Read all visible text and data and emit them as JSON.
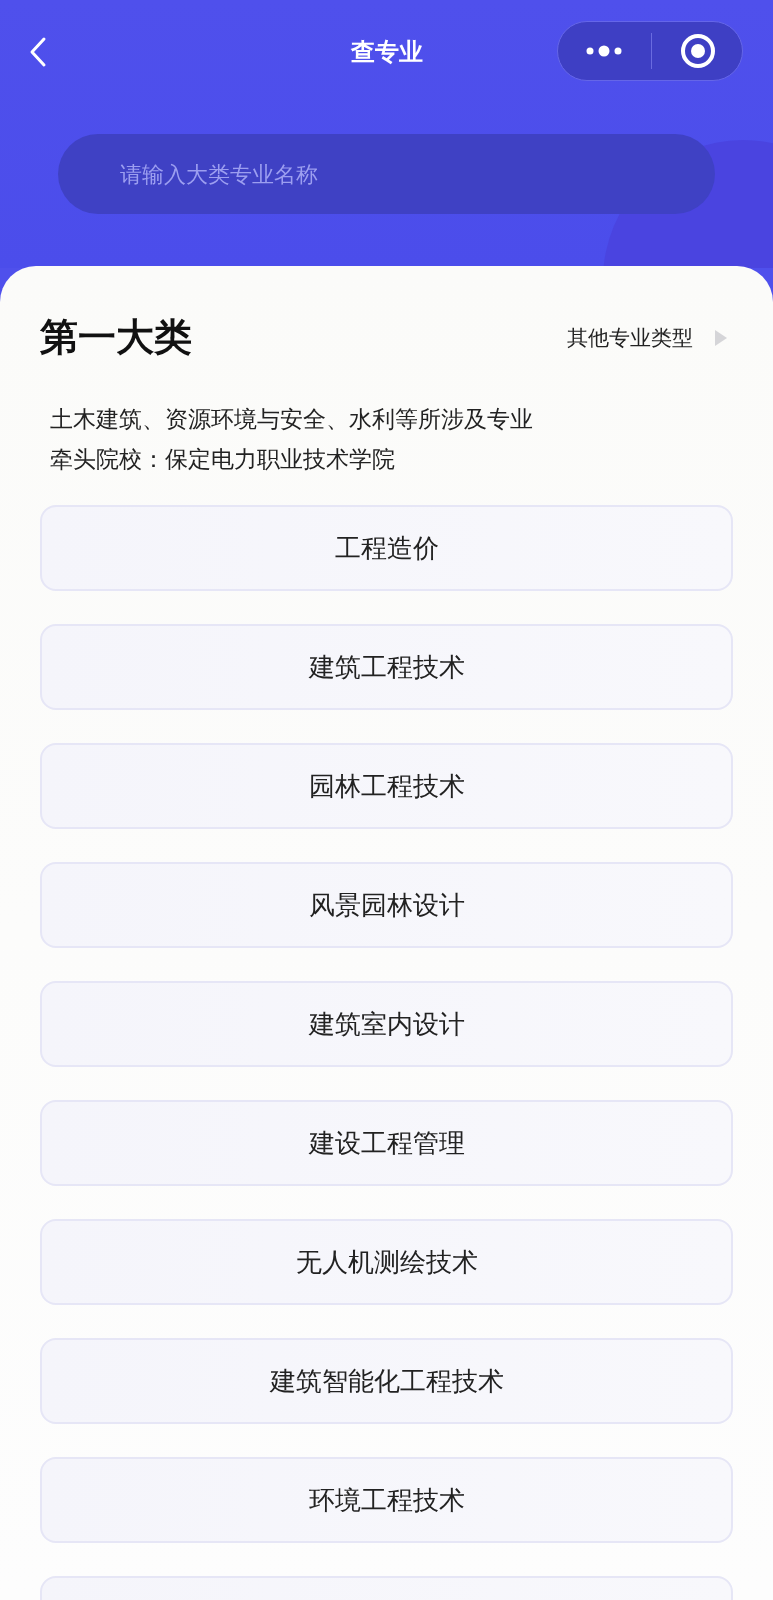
{
  "nav": {
    "title": "查专业"
  },
  "search": {
    "placeholder": "请输入大类专业名称"
  },
  "category": {
    "title": "第一大类",
    "other_link": "其他专业类型",
    "description": "土木建筑、资源环境与安全、水利等所涉及专业",
    "lead_school": "牵头院校：保定电力职业技术学院"
  },
  "majors": [
    "工程造价",
    "建筑工程技术",
    "园林工程技术",
    "风景园林设计",
    "建筑室内设计",
    "建设工程管理",
    "无人机测绘技术",
    "建筑智能化工程技术",
    "环境工程技术"
  ]
}
